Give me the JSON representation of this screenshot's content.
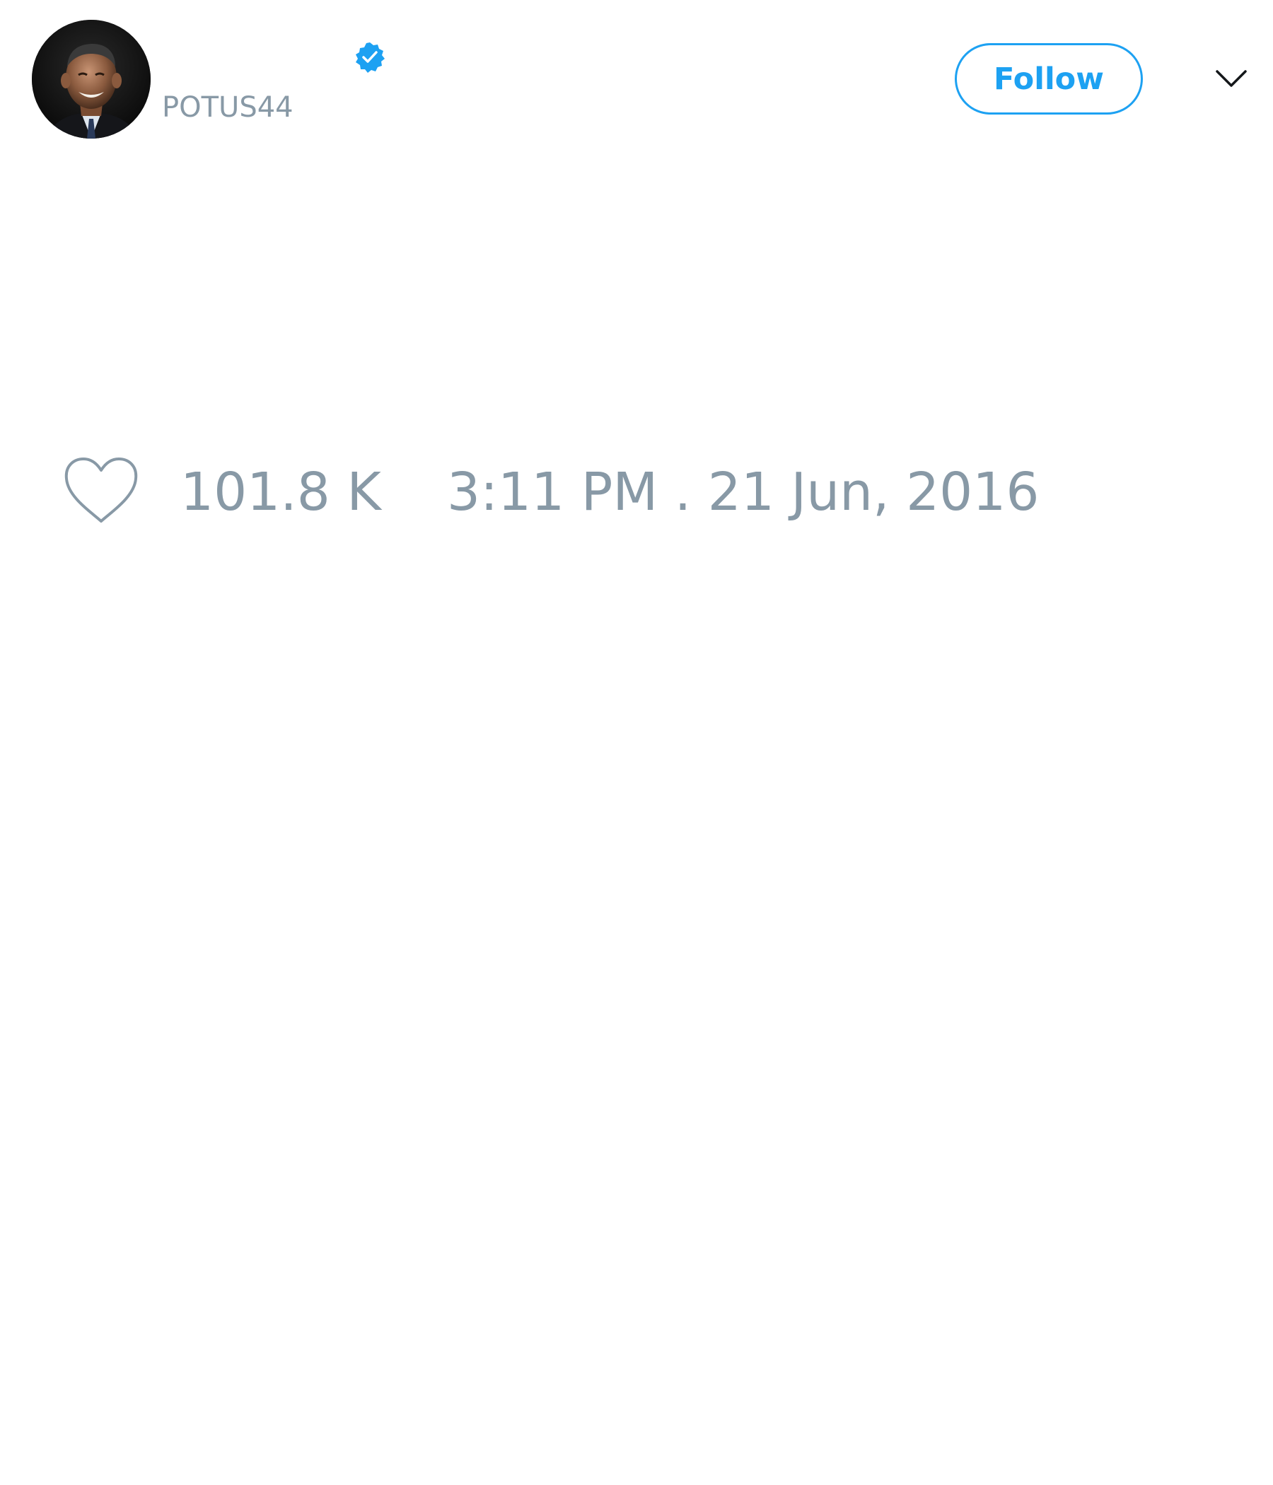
{
  "user": {
    "display_name": "",
    "handle": "POTUS44",
    "verified": true
  },
  "actions": {
    "follow_label": "Follow"
  },
  "icons": {
    "verified": "verified-badge-icon",
    "menu": "chevron-down-icon",
    "like": "heart-icon"
  },
  "tweet": {
    "like_count": "101.8 K",
    "timestamp": "3:11 PM . 21 Jun, 2016"
  },
  "colors": {
    "accent": "#1da1f2",
    "muted_text": "#8899a6",
    "background": "#ffffff"
  }
}
